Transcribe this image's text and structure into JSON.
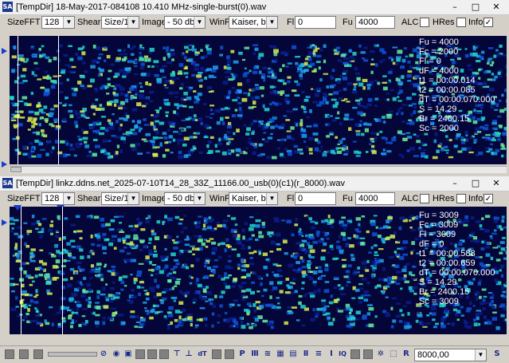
{
  "window1": {
    "title": "[TempDir] 18-May-2017-084108 10.410 MHz-single-burst(0).wav",
    "toolbar": {
      "sizefft_label": "SizeFFT",
      "sizefft_value": "128",
      "shear_label": "Shear",
      "shear_value": "Size/16",
      "image_label": "Image",
      "image_value": "- 50 db",
      "winf_label": "WinF",
      "winf_value": "Kaiser, b=8",
      "fl_label": "Fl",
      "fl_value": "0",
      "fu_label": "Fu",
      "fu_value": "4000",
      "alc_label": "ALC",
      "hres_label": "HRes",
      "info_label": "Info",
      "alc_checked": "",
      "hres_checked": "",
      "info_checked": "✓"
    },
    "info_lines": [
      "Fu = 4000",
      "Fc = 2000",
      "Fl = 0",
      "dF = 4000",
      "t1 = 00:00.014",
      "t2 = 00:00.085",
      "dT = 00:00.070.000",
      "S = 14.29",
      "Br = 2400.15",
      "Sc = 2000"
    ]
  },
  "window2": {
    "title": "[TempDir] linkz.ddns.net_2025-07-10T14_28_33Z_11166.00_usb(0)(c1)(r_8000).wav",
    "toolbar": {
      "sizefft_label": "SizeFFT",
      "sizefft_value": "128",
      "shear_label": "Shear",
      "shear_value": "Size/16",
      "image_label": "Image",
      "image_value": "- 50 db",
      "winf_label": "WinF",
      "winf_value": "Kaiser, b=8",
      "fl_label": "Fl",
      "fl_value": "0",
      "fu_label": "Fu",
      "fu_value": "4000",
      "alc_label": "ALC",
      "hres_label": "HRes",
      "info_label": "Info",
      "alc_checked": "",
      "hres_checked": "",
      "info_checked": "✓"
    },
    "info_lines": [
      "Fu = 3009",
      "Fc = 3009",
      "Fl = 3009",
      "dF = 0",
      "t1 = 00:00.588",
      "t2 = 00:00.659",
      "dT = 00:00.070.000",
      "S = 14.29",
      "Br = 2400.15",
      "Sc = 3009"
    ]
  },
  "bottom": {
    "sample_rate_value": "8000,00",
    "s_button": "S"
  },
  "colors": {
    "spectrogram_bg": "#04063a",
    "marker": "#ffffff",
    "marker_triangle": "#1a3ad0"
  }
}
